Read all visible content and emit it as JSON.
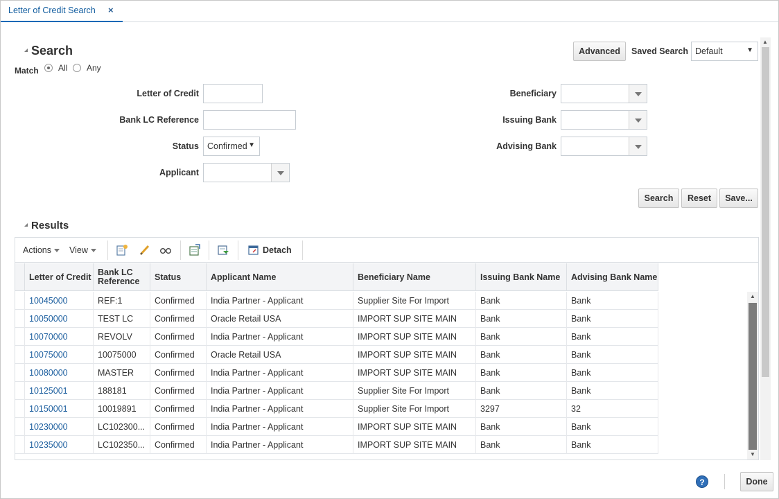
{
  "tabs": [
    {
      "label": "Letter of Credit Search",
      "close": "×"
    }
  ],
  "search": {
    "title": "Search",
    "match_label": "Match",
    "match_options": [
      "All",
      "Any"
    ],
    "match_selected": "All",
    "advanced_label": "Advanced",
    "saved_search_label": "Saved Search",
    "saved_search_value": "Default",
    "fields": {
      "letter_of_credit": {
        "label": "Letter of Credit",
        "value": ""
      },
      "bank_lc_reference": {
        "label": "Bank LC Reference",
        "value": ""
      },
      "status": {
        "label": "Status",
        "value": "Confirmed"
      },
      "applicant": {
        "label": "Applicant",
        "value": ""
      },
      "beneficiary": {
        "label": "Beneficiary",
        "value": ""
      },
      "issuing_bank": {
        "label": "Issuing Bank",
        "value": ""
      },
      "advising_bank": {
        "label": "Advising Bank",
        "value": ""
      }
    },
    "buttons": {
      "search": "Search",
      "reset": "Reset",
      "save": "Save..."
    }
  },
  "results": {
    "title": "Results",
    "toolbar": {
      "actions": "Actions",
      "view": "View",
      "detach": "Detach"
    },
    "columns": [
      "Letter of Credit",
      "Bank LC Reference",
      "Status",
      "Applicant Name",
      "Beneficiary Name",
      "Issuing Bank Name",
      "Advising Bank Name"
    ],
    "rows": [
      [
        "10045000",
        "REF:1",
        "Confirmed",
        "India Partner - Applicant",
        "Supplier Site For Import",
        "Bank",
        "Bank"
      ],
      [
        "10050000",
        "TEST LC",
        "Confirmed",
        "Oracle Retail USA",
        "IMPORT SUP SITE MAIN",
        "Bank",
        "Bank"
      ],
      [
        "10070000",
        "REVOLV",
        "Confirmed",
        "India Partner - Applicant",
        "IMPORT SUP SITE MAIN",
        "Bank",
        "Bank"
      ],
      [
        "10075000",
        "10075000",
        "Confirmed",
        "Oracle Retail USA",
        "IMPORT SUP SITE MAIN",
        "Bank",
        "Bank"
      ],
      [
        "10080000",
        "MASTER",
        "Confirmed",
        "India Partner - Applicant",
        "IMPORT SUP SITE MAIN",
        "Bank",
        "Bank"
      ],
      [
        "10125001",
        "188181",
        "Confirmed",
        "India Partner - Applicant",
        "Supplier Site For Import",
        "Bank",
        "Bank"
      ],
      [
        "10150001",
        "10019891",
        "Confirmed",
        "India Partner - Applicant",
        "Supplier Site For Import",
        "3297",
        "32"
      ],
      [
        "10230000",
        "LC102300...",
        "Confirmed",
        "India Partner - Applicant",
        "IMPORT SUP SITE MAIN",
        "Bank",
        "Bank"
      ],
      [
        "10235000",
        "LC102350...",
        "Confirmed",
        "India Partner - Applicant",
        "IMPORT SUP SITE MAIN",
        "Bank",
        "Bank"
      ]
    ]
  },
  "footer": {
    "help": "?",
    "done": "Done"
  },
  "colors": {
    "link": "#1d5f9f",
    "tab_accent": "#0f69b6"
  },
  "icons": [
    "create-icon",
    "edit-icon",
    "view-icon",
    "export-icon",
    "apply-icon",
    "detach-icon",
    "help-icon"
  ]
}
